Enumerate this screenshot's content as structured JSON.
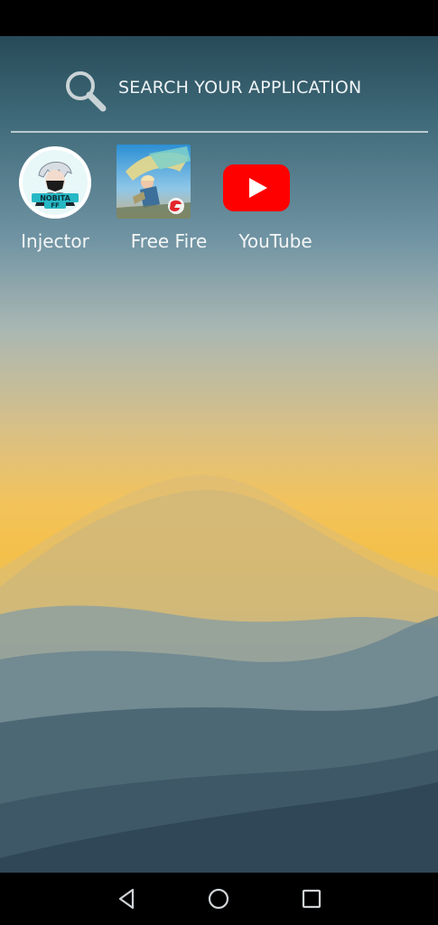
{
  "search": {
    "label": "SEARCH YOUR APPLICATION",
    "icon": "search-icon"
  },
  "apps": [
    {
      "label": "Injector",
      "icon": "injector-app-icon"
    },
    {
      "label": "Free Fire",
      "icon": "free-fire-app-icon"
    },
    {
      "label": "YouTube",
      "icon": "youtube-app-icon"
    }
  ],
  "nav": {
    "back_icon": "back-triangle-icon",
    "home_icon": "home-circle-icon",
    "recents_icon": "recents-square-icon"
  },
  "colors": {
    "wallpaper_sky_top": "#274a58",
    "wallpaper_sunset": "#f4c04a",
    "youtube_red": "#ff0000",
    "text_light": "#eef3f5"
  }
}
